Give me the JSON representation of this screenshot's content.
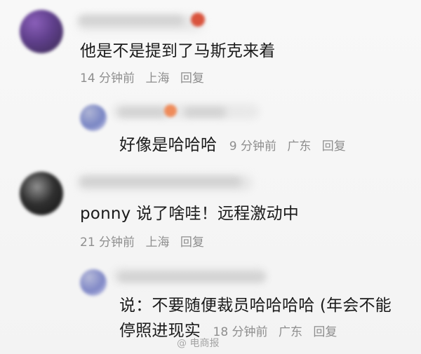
{
  "comments": [
    {
      "text": "他是不是提到了马斯克来着",
      "time": "14 分钟前",
      "location": "上海",
      "reply": "回复"
    },
    {
      "text": "好像是哈哈哈",
      "time": "9 分钟前",
      "location": "广东",
      "reply": "回复"
    },
    {
      "text": "ponny 说了啥哇！远程激动中",
      "time": "21 分钟前",
      "location": "上海",
      "reply": "回复"
    },
    {
      "line1": "说：不要随便裁员哈哈哈哈 (年会不能",
      "line2": "停照进现实",
      "time": "18 分钟前",
      "location": "广东",
      "reply": "回复"
    }
  ],
  "watermark": {
    "at": "@",
    "label": "电商报"
  }
}
